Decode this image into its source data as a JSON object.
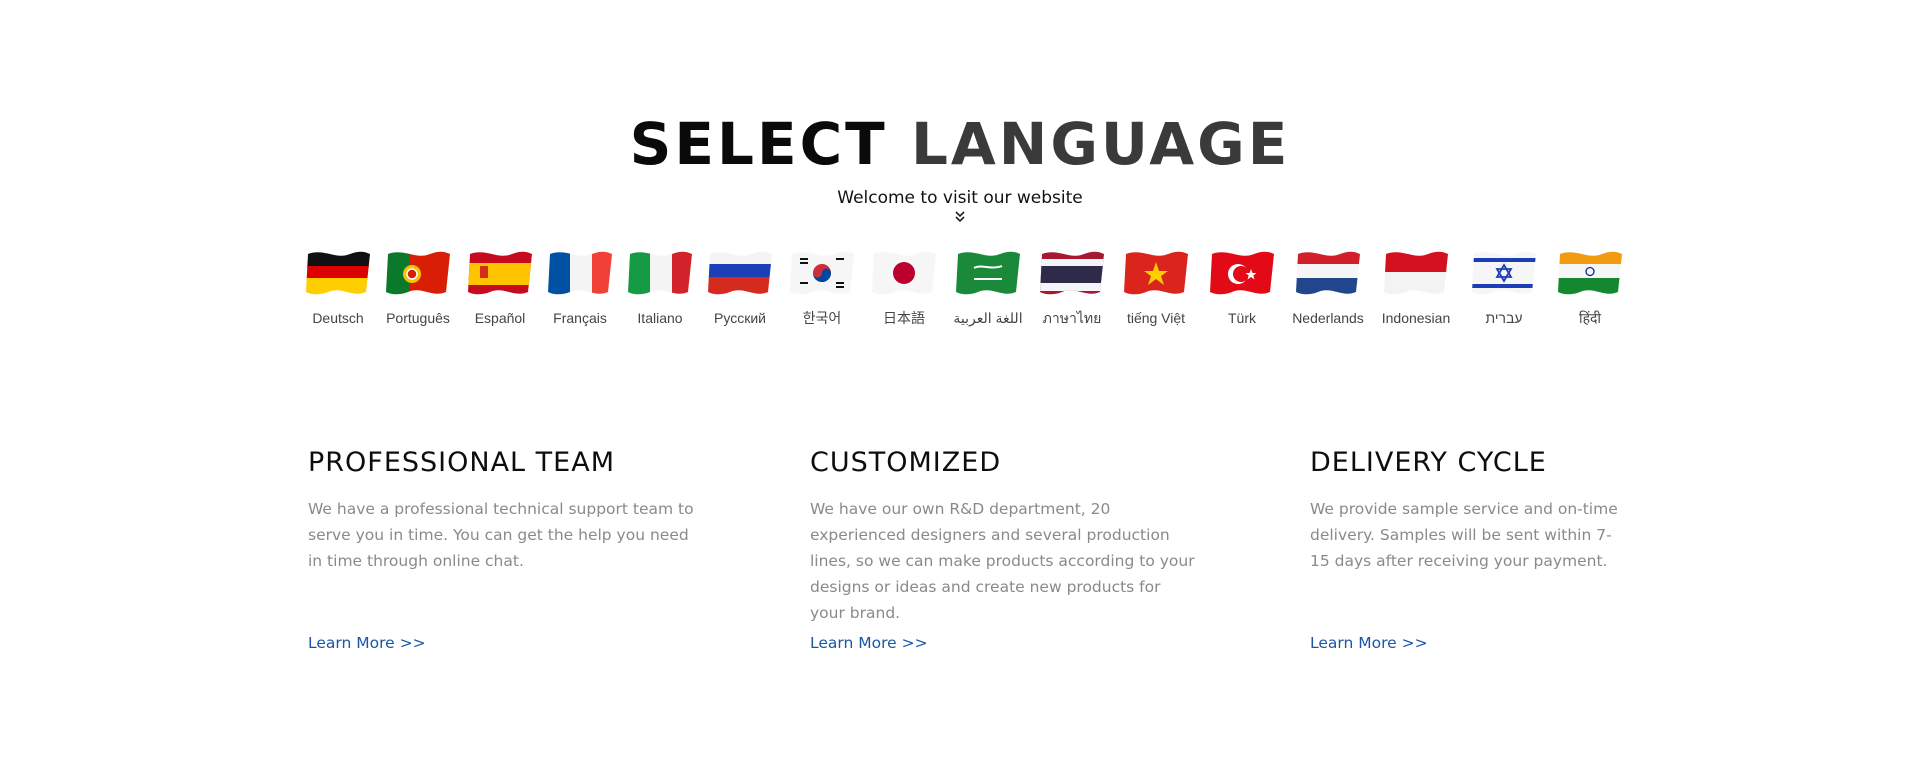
{
  "hero": {
    "title_word1": "SELECT",
    "title_word2": "LANGUAGE",
    "subtitle": "Welcome to visit our website",
    "scroll_icon": "double-chevron-down-icon"
  },
  "languages": [
    {
      "label": "Deutsch",
      "flag": "germany-flag"
    },
    {
      "label": "Português",
      "flag": "portugal-flag"
    },
    {
      "label": "Español",
      "flag": "spain-flag"
    },
    {
      "label": "Français",
      "flag": "france-flag"
    },
    {
      "label": "Italiano",
      "flag": "italy-flag"
    },
    {
      "label": "Русский",
      "flag": "russia-flag"
    },
    {
      "label": "한국어",
      "flag": "south-korea-flag"
    },
    {
      "label": "日本語",
      "flag": "japan-flag"
    },
    {
      "label": "اللغة العربية",
      "flag": "saudi-arabia-flag"
    },
    {
      "label": "ภาษาไทย",
      "flag": "thailand-flag"
    },
    {
      "label": "tiếng Việt",
      "flag": "vietnam-flag"
    },
    {
      "label": "Türk",
      "flag": "turkey-flag"
    },
    {
      "label": "Nederlands",
      "flag": "netherlands-flag"
    },
    {
      "label": "Indonesian",
      "flag": "indonesia-flag"
    },
    {
      "label": "עברית",
      "flag": "israel-flag"
    },
    {
      "label": "हिंदी",
      "flag": "india-flag"
    }
  ],
  "features": [
    {
      "title": "PROFESSIONAL TEAM",
      "description": "We have a professional technical support team to serve you in time. You can get the help you need in time through online chat.",
      "link": "Learn More >>"
    },
    {
      "title": "CUSTOMIZED",
      "description": "We have our own R&D department, 20 experienced designers and several production lines, so we can make products according to your designs or ideas and create new products for your brand.",
      "link": "Learn More >>"
    },
    {
      "title": "DELIVERY CYCLE",
      "description": "We provide sample service and on-time delivery. Samples will be sent within 7-15 days after receiving your payment.",
      "link": "Learn More >>"
    }
  ],
  "colors": {
    "link": "#1a56a8",
    "body_text": "#8a8a8a",
    "heading": "#0d0d0d"
  }
}
